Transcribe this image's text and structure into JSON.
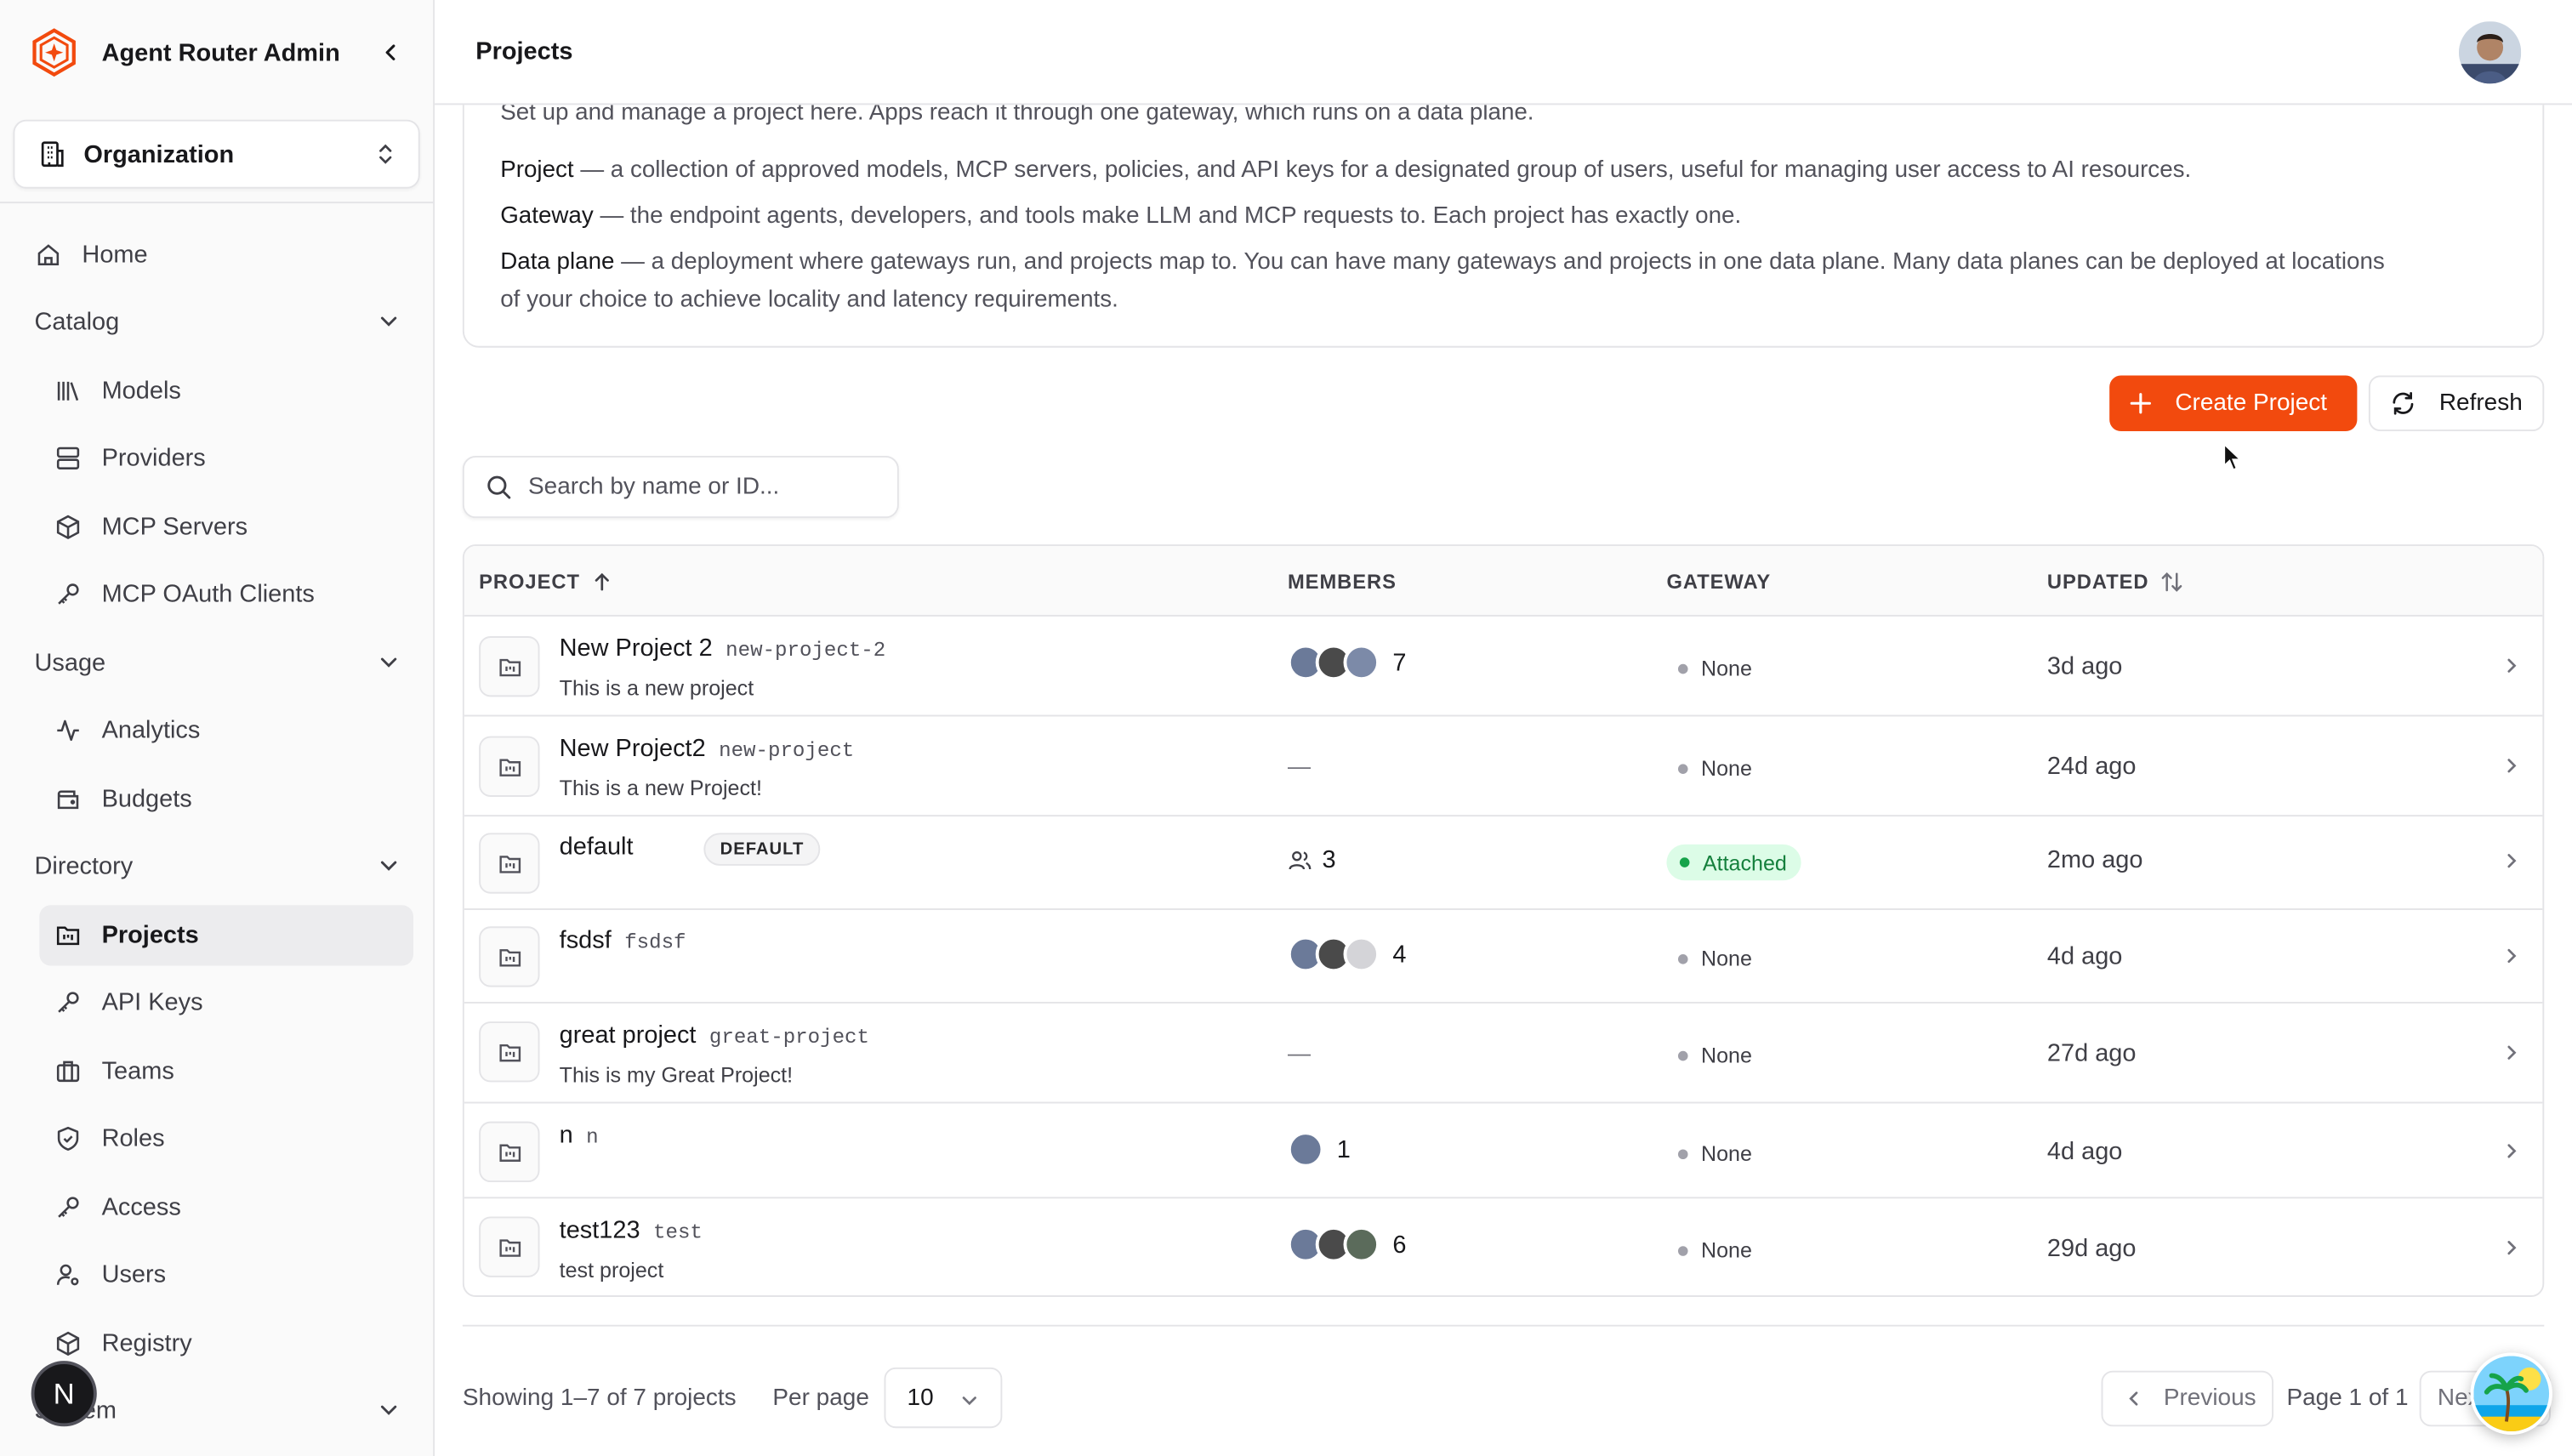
{
  "app": {
    "title": "Agent Router Admin",
    "brand_color": "#f24a0e"
  },
  "org_selector": {
    "label": "Organization"
  },
  "sidebar": {
    "home": "Home",
    "groups": {
      "catalog": "Catalog",
      "usage": "Usage",
      "directory": "Directory",
      "system": "System"
    },
    "items": {
      "models": "Models",
      "providers": "Providers",
      "mcp_servers": "MCP Servers",
      "mcp_oauth": "MCP OAuth Clients",
      "analytics": "Analytics",
      "budgets": "Budgets",
      "projects": "Projects",
      "api_keys": "API Keys",
      "teams": "Teams",
      "roles": "Roles",
      "access": "Access",
      "users": "Users",
      "registry": "Registry"
    },
    "user_initial": "N"
  },
  "header": {
    "title": "Projects"
  },
  "info": {
    "intro": "Set up and manage a project here. Apps reach it through one gateway, which runs on a data plane.",
    "project_term": "Project",
    "project_def": " — a collection of approved models, MCP servers, policies, and API keys for a designated group of users, useful for managing user access to AI resources.",
    "gateway_term": "Gateway",
    "gateway_def": " — the endpoint agents, developers, and tools make LLM and MCP requests to. Each project has exactly one.",
    "dataplane_term": "Data plane",
    "dataplane_def_1": " — a deployment where gateways run, and projects map to. You can have many gateways and projects in one data plane. Many data planes can be deployed at locations",
    "dataplane_def_2": "of your choice to achieve locality and latency requirements."
  },
  "actions": {
    "create": "Create Project",
    "refresh": "Refresh"
  },
  "search": {
    "placeholder": "Search by name or ID..."
  },
  "table": {
    "columns": {
      "project": "PROJECT",
      "members": "MEMBERS",
      "gateway": "GATEWAY",
      "updated": "UPDATED"
    },
    "rows": [
      {
        "name": "New Project 2",
        "id": "new-project-2",
        "desc": "This is a new project",
        "members": "7",
        "gateway": "None",
        "updated": "3d ago"
      },
      {
        "name": "New Project2",
        "id": "new-project",
        "desc": "This is a new Project!",
        "members": "—",
        "gateway": "None",
        "updated": "24d ago"
      },
      {
        "name": "default",
        "badge": "DEFAULT",
        "members": "3",
        "gateway": "Attached",
        "updated": "2mo ago"
      },
      {
        "name": "fsdsf",
        "id": "fsdsf",
        "members": "4",
        "gateway": "None",
        "updated": "4d ago"
      },
      {
        "name": "great project",
        "id": "great-project",
        "desc": "This is my Great Project!",
        "members": "—",
        "gateway": "None",
        "updated": "27d ago"
      },
      {
        "name": "n",
        "id": "n",
        "members": "1",
        "gateway": "None",
        "updated": "4d ago"
      },
      {
        "name": "test123",
        "id": "test",
        "desc": "test project",
        "members": "6",
        "gateway": "None",
        "updated": "29d ago"
      }
    ]
  },
  "footer": {
    "showing": "Showing 1–7 of 7 projects",
    "per_page_label": "Per page",
    "per_page_value": "10",
    "prev": "Previous",
    "page_info": "Page 1 of 1",
    "next": "Next"
  }
}
